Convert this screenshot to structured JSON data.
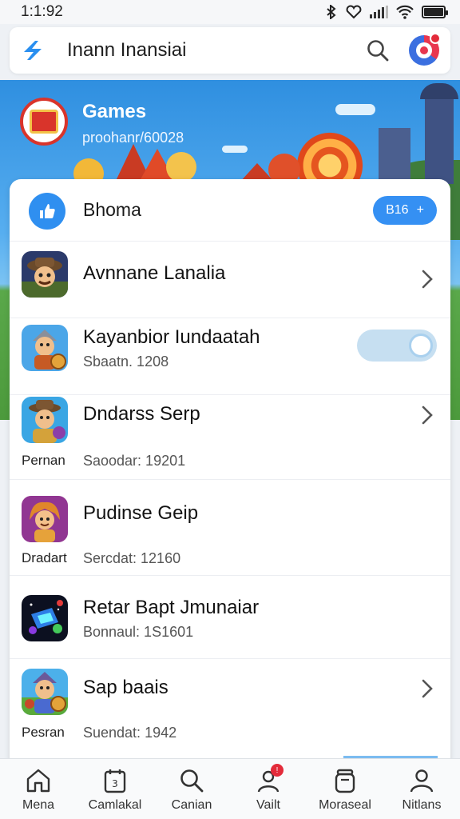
{
  "status_bar": {
    "time": "1:1:92"
  },
  "search": {
    "title": "Inann Inansiai"
  },
  "hero": {
    "title": "Games",
    "subtitle": "proohanr/60028"
  },
  "card": {
    "title": "Bhoma",
    "pill_label": "B16",
    "pill_plus": "+"
  },
  "list": [
    {
      "title": "Avnnane Lanalia",
      "subtitle": "",
      "left": "",
      "control": "chevron"
    },
    {
      "title": "Kayanbior Iundaatah",
      "subtitle": "Sbaatn. 1208",
      "left": "",
      "control": "toggle",
      "toggle_on": true
    },
    {
      "title": "Dndarss Serp",
      "subtitle": "Saoodar: 19201",
      "left": "Pernan",
      "control": "chevron"
    },
    {
      "title": "Pudinse Geip",
      "subtitle": "Sercdat: 12160",
      "left": "Dradart",
      "control": "none"
    },
    {
      "title": "Retar Bapt Jmunaiar",
      "subtitle": "Bonnaul: 1S1601",
      "left": "",
      "control": "none"
    },
    {
      "title": "Sap baais",
      "subtitle": "Suendat: 1942",
      "left": "Pesran",
      "control": "chevron"
    }
  ],
  "nav": [
    {
      "label": "Mena",
      "icon": "home-icon"
    },
    {
      "label": "Camlakal",
      "icon": "calendar-icon"
    },
    {
      "label": "Canian",
      "icon": "search-icon"
    },
    {
      "label": "Vailt",
      "icon": "user-alert-icon",
      "badge": "!"
    },
    {
      "label": "Moraseal",
      "icon": "jar-icon"
    },
    {
      "label": "Nitlans",
      "icon": "profile-icon"
    }
  ],
  "colors": {
    "accent": "#3590f3",
    "badge": "#e32b3a"
  }
}
